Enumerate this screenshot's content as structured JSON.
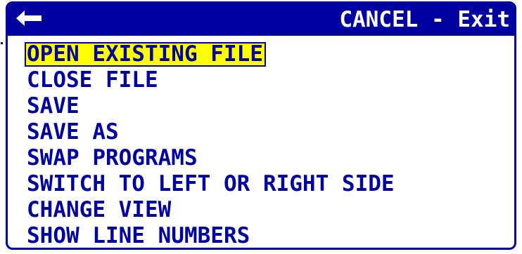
{
  "title_bar": {
    "back_icon": "back-arrow-icon",
    "title": "CANCEL - Exit"
  },
  "menu": {
    "items": [
      {
        "label": "OPEN EXISTING FILE",
        "selected": true
      },
      {
        "label": "CLOSE FILE",
        "selected": false
      },
      {
        "label": "SAVE",
        "selected": false
      },
      {
        "label": "SAVE AS",
        "selected": false
      },
      {
        "label": "SWAP PROGRAMS",
        "selected": false
      },
      {
        "label": "SWITCH TO LEFT OR RIGHT SIDE",
        "selected": false
      },
      {
        "label": "CHANGE VIEW",
        "selected": false
      },
      {
        "label": "SHOW LINE NUMBERS",
        "selected": false
      }
    ]
  },
  "colors": {
    "frame": "#0000a0",
    "title_text": "#ffffff",
    "item_text": "#0000a0",
    "selection_highlight": "#ffff00"
  }
}
